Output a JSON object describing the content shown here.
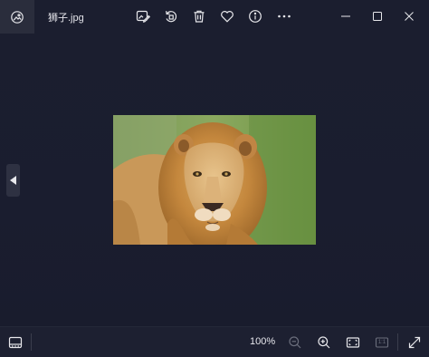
{
  "window": {
    "title": "狮子.jpg"
  },
  "toolbar": {
    "icons": [
      "app-photos-icon",
      "edit-image-icon",
      "rotate-icon",
      "delete-icon",
      "favorite-icon",
      "info-icon",
      "more-icon"
    ]
  },
  "window_controls": [
    "minimize",
    "maximize",
    "close"
  ],
  "viewer": {
    "prev_icon": "chevron-left-icon"
  },
  "bottombar": {
    "zoom_label": "100%",
    "ratio_label": "1:1",
    "icons": [
      "filmstrip-icon",
      "zoom-out-icon",
      "zoom-in-icon",
      "fit-to-window-icon",
      "actual-size-icon",
      "fullscreen-icon"
    ]
  },
  "colors": {
    "background": "#1a1d2e",
    "bar": "#1d2031",
    "icon": "#e8e8ec",
    "disabled": "#6b6e7c"
  }
}
